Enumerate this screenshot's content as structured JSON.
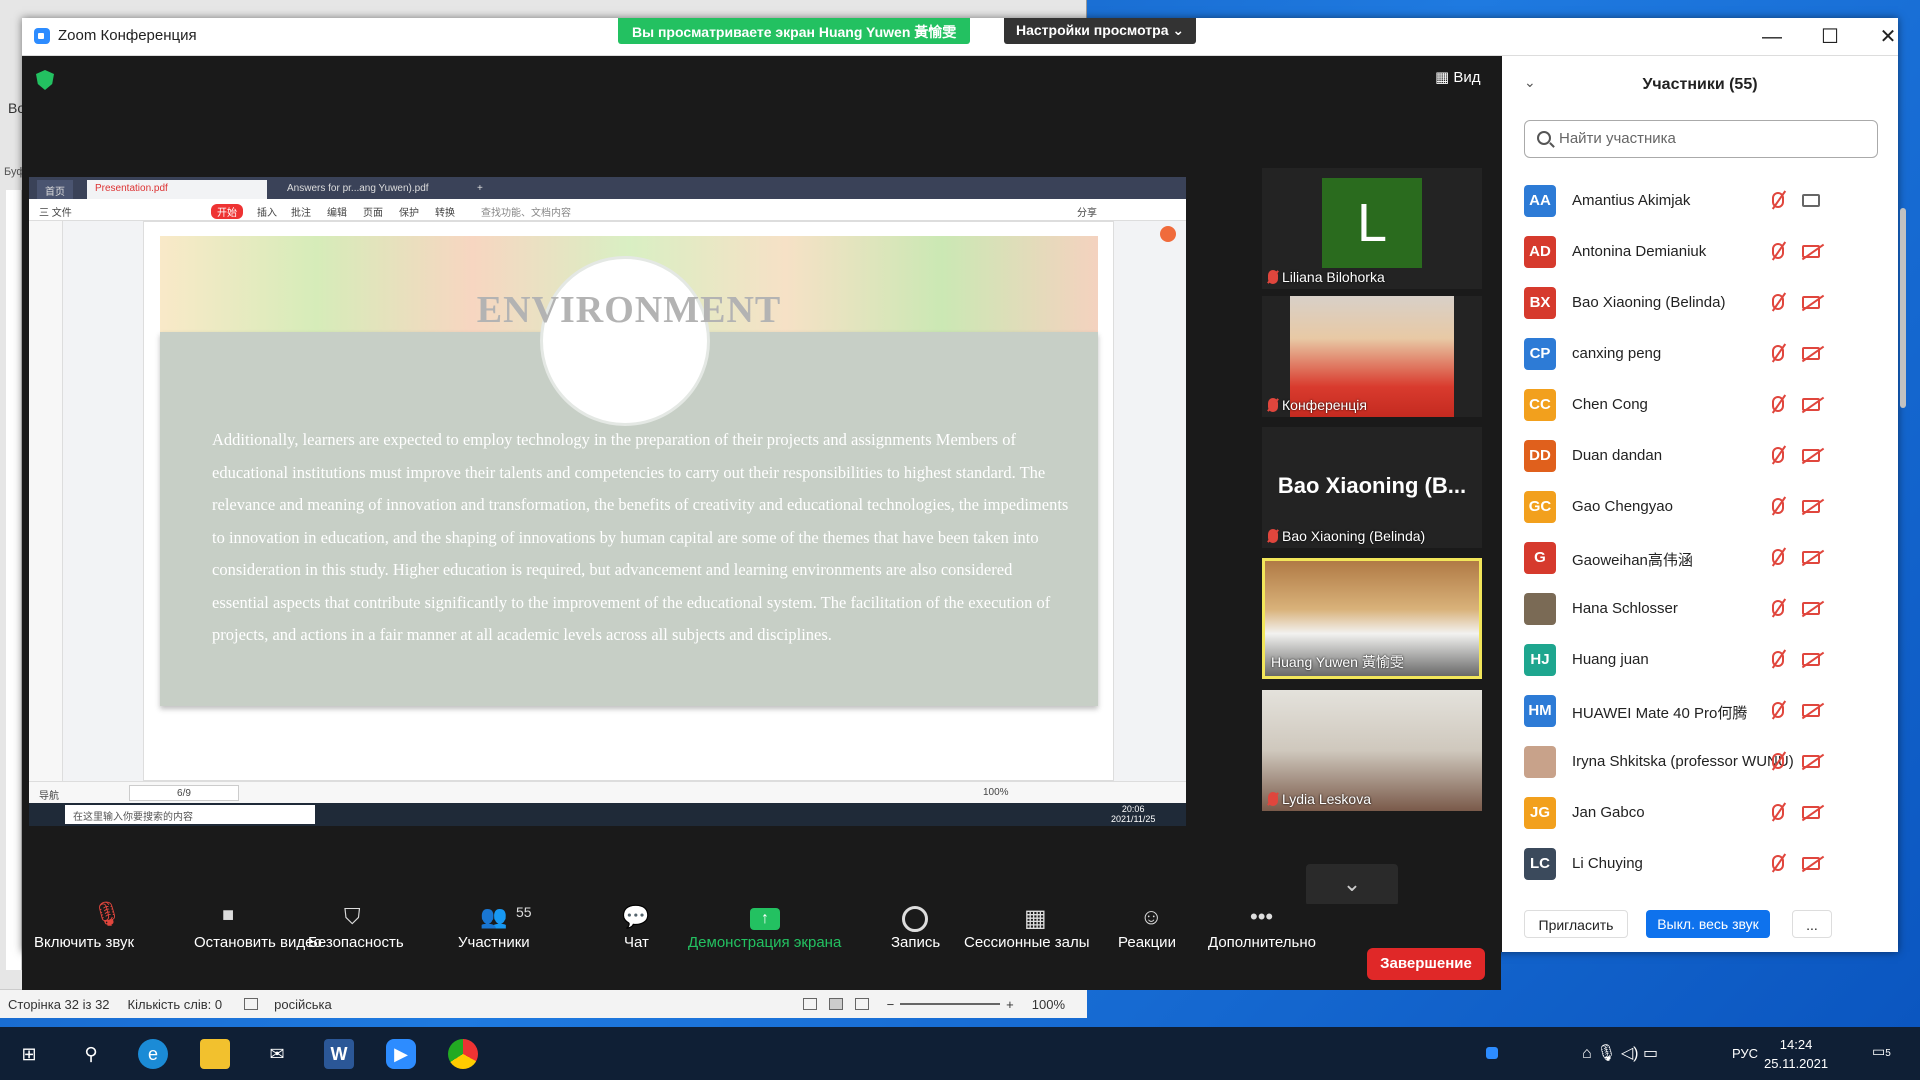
{
  "zoom": {
    "title": "Zoom Конференция",
    "viewing_banner": "Вы просматриваете экран Huang Yuwen 黃愉雯",
    "view_settings": "Настройки просмотра ⌄",
    "view_label": "Вид",
    "min": "—",
    "max": "☐",
    "close": "✕"
  },
  "pdf": {
    "tab_home": "首页",
    "tab1": "Presentation.pdf",
    "tab2": "Answers for pr...ang Yuwen).pdf",
    "tab_add": "+",
    "menu_file": "三 文件",
    "menu_start": "开始",
    "menu_insert": "插入",
    "menu_comment": "批注",
    "menu_edit": "编辑",
    "menu_page": "页面",
    "menu_protect": "保护",
    "menu_convert": "转换",
    "menu_search": "查找功能、文档内容",
    "menu_share": "分享",
    "nav_label": "导航",
    "page_indicator": "6/9",
    "zoom_pct": "100%",
    "slide_title": "ENVIRONMENT",
    "slide_text": "Additionally, learners are expected to employ technology in the preparation of their projects and assignments Members of educational institutions must improve their talents and competencies to carry out their responsibilities to highest standard. The relevance and meaning of innovation and transformation, the benefits of creativity and educational technologies, the impediments to innovation in education, and the shaping of innovations by human capital are some of the themes that have been taken into consideration in this study. Higher education is required, but advancement and learning environments are also considered essential aspects that contribute significantly to the improvement of the educational system. The facilitation of the execution of projects, and actions in a fair manner at all academic levels across all subjects and disciplines.",
    "inner_search": "在这里输入你要搜索的内容",
    "inner_time": "20:06",
    "inner_date": "2021/11/25"
  },
  "gallery": [
    {
      "name": "Liliana Bilohorka",
      "initial": "L"
    },
    {
      "name": "Конференція"
    },
    {
      "name": "Bao Xiaoning (Belinda)",
      "display": "Bao Xiaoning (B..."
    },
    {
      "name": "Huang Yuwen 黃愉雯"
    },
    {
      "name": "Lydia Leskova"
    }
  ],
  "controls": {
    "audio": "Включить звук",
    "video": "Остановить видео",
    "security": "Безопасность",
    "participants": "Участники",
    "participants_count": "55",
    "chat": "Чат",
    "share": "Демонстрация экрана",
    "record": "Запись",
    "breakout": "Сессионные залы",
    "reactions": "Реакции",
    "more": "Дополнительно",
    "end": "Завершение"
  },
  "panel": {
    "title": "Участники (55)",
    "search_placeholder": "Найти участника",
    "participants": [
      {
        "initials": "AA",
        "name": "Amantius Akimjak",
        "color": "#2d7bd6"
      },
      {
        "initials": "AD",
        "name": "Antonina Demianiuk",
        "color": "#d63a2d"
      },
      {
        "initials": "BX",
        "name": "Bao Xiaoning (Belinda)",
        "color": "#d63a2d"
      },
      {
        "initials": "CP",
        "name": "canxing peng",
        "color": "#2d7bd6"
      },
      {
        "initials": "CC",
        "name": "Chen Cong",
        "color": "#f2a01d"
      },
      {
        "initials": "DD",
        "name": "Duan dandan",
        "color": "#e0601c"
      },
      {
        "initials": "GC",
        "name": "Gao Chengyao",
        "color": "#f2a01d"
      },
      {
        "initials": "G",
        "name": "Gaoweihan高伟涵",
        "color": "#d63a2d"
      },
      {
        "initials": "",
        "name": "Hana Schlosser",
        "color": "#7a6a55"
      },
      {
        "initials": "HJ",
        "name": "Huang juan",
        "color": "#1ea68f"
      },
      {
        "initials": "HM",
        "name": "HUAWEI Mate 40 Pro何腾",
        "color": "#2d7bd6"
      },
      {
        "initials": "",
        "name": "Iryna Shkitska (professor WUNU)",
        "color": "#c8a28a"
      },
      {
        "initials": "JG",
        "name": "Jan Gabco",
        "color": "#f2a01d"
      },
      {
        "initials": "LC",
        "name": "Li Chuying",
        "color": "#3b4a5c"
      }
    ],
    "invite": "Пригласить",
    "mute_all": "Выкл. весь звук",
    "more": "..."
  },
  "word": {
    "page": "Сторінка 32 із 32",
    "words": "Кількість слів: 0",
    "lang": "російська",
    "zoom": "100%",
    "left_frag1": "Во",
    "left_frag2": "Буф"
  },
  "taskbar": {
    "lang": "РУС",
    "time": "14:24",
    "date": "25.11.2021",
    "notif": "5"
  }
}
